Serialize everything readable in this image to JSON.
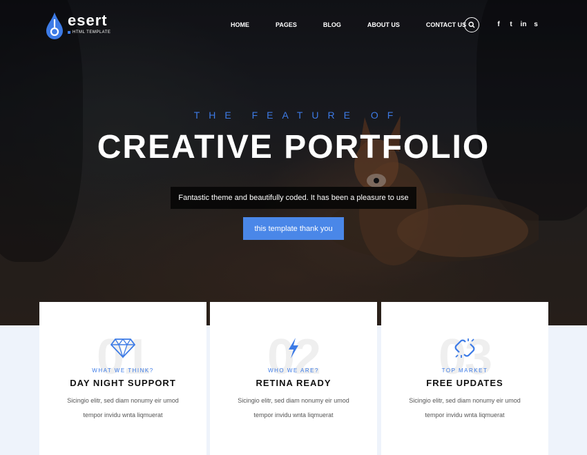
{
  "brand": {
    "name": "esert",
    "subtitle": "HTML TEMPLATE",
    "accent_color": "#3d7be6"
  },
  "nav": {
    "items": [
      "HOME",
      "PAGES",
      "BLOG",
      "ABOUT US",
      "CONTACT US"
    ]
  },
  "social": {
    "icons": [
      {
        "name": "facebook-icon",
        "glyph": "f"
      },
      {
        "name": "twitter-icon",
        "glyph": "t"
      },
      {
        "name": "linkedin-icon",
        "glyph": "in"
      },
      {
        "name": "skype-icon",
        "glyph": "s"
      }
    ]
  },
  "hero": {
    "subtitle": "THE FEATURE OF",
    "title": "CREATIVE PORTFOLIO",
    "tagline": "Fantastic theme and beautifully coded. It has been a pleasure to use",
    "cta_label": "this template thank you"
  },
  "cards": [
    {
      "number": "01",
      "icon": "diamond-icon",
      "label": "WHAT WE THINK?",
      "title": "DAY NIGHT SUPPORT",
      "desc_line1": "Sicingio elitr, sed diam nonumy eir umod",
      "desc_line2": "tempor invidu wnta liqmuerat"
    },
    {
      "number": "02",
      "icon": "lightning-icon",
      "label": "WHO WE ARE?",
      "title": "RETINA READY",
      "desc_line1": "Sicingio elitr, sed diam nonumy eir umod",
      "desc_line2": "tempor invidu wnta liqmuerat"
    },
    {
      "number": "03",
      "icon": "broken-link-icon",
      "label": "TOP MARKET",
      "title": "FREE UPDATES",
      "desc_line1": "Sicingio elitr, sed diam nonumy eir umod",
      "desc_line2": "tempor invidu wnta liqmuerat"
    }
  ]
}
